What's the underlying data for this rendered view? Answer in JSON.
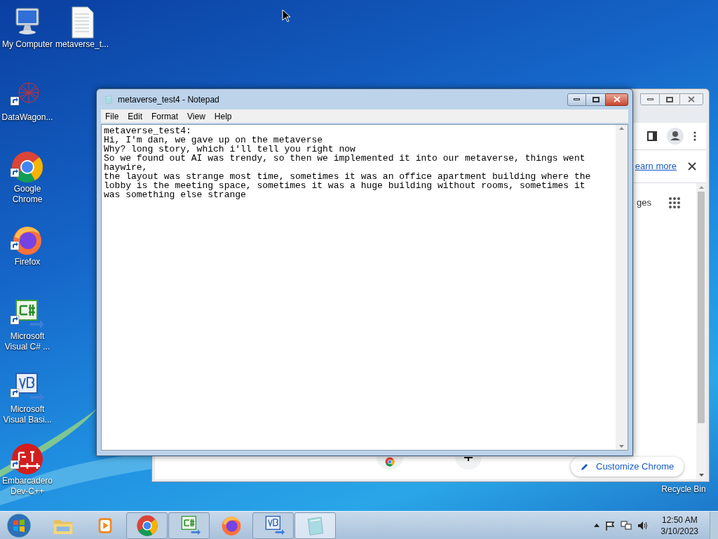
{
  "desktop_icons": [
    {
      "label": "My Computer",
      "kind": "computer"
    },
    {
      "label": "metaverse_t...",
      "kind": "document"
    },
    {
      "label": "DataWagon...",
      "kind": "datawagon"
    },
    {
      "label": "Google Chrome",
      "kind": "chrome"
    },
    {
      "label": "Firefox",
      "kind": "firefox"
    },
    {
      "label": "Microsoft Visual C# ...",
      "kind": "csharp"
    },
    {
      "label": "Microsoft Visual Basi...",
      "kind": "vb"
    },
    {
      "label": "Embarcadero Dev-C++",
      "kind": "devcpp"
    }
  ],
  "recycle_bin": {
    "label": "Recycle Bin"
  },
  "chrome": {
    "link": "earn more",
    "partial_text": "ges",
    "customize_button": "Customize Chrome"
  },
  "notepad": {
    "title": "metaverse_test4 - Notepad",
    "menu": [
      "File",
      "Edit",
      "Format",
      "View",
      "Help"
    ],
    "lines": [
      "metaverse_test4:",
      "Hi, I'm dan, we gave up on the metaverse",
      "Why? long story, which i'll tell you right now",
      "So we found out AI was trendy, so then we implemented it into our metaverse, things went",
      "haywire,",
      "the layout was strange most time, sometimes it was an office apartment building where the",
      "lobby is the meeting space, sometimes it was a huge building without rooms, sometimes it",
      "was something else strange"
    ]
  },
  "taskbar": {
    "items": [
      {
        "kind": "explorer",
        "running": false,
        "selected": false
      },
      {
        "kind": "mediaplayer",
        "running": false,
        "selected": false
      },
      {
        "kind": "chrome",
        "running": true,
        "selected": false
      },
      {
        "kind": "csharp",
        "running": true,
        "selected": false
      },
      {
        "kind": "firefox",
        "running": false,
        "selected": false
      },
      {
        "kind": "vb",
        "running": true,
        "selected": false
      },
      {
        "kind": "notepad",
        "running": true,
        "selected": true
      }
    ],
    "clock": {
      "time": "12:50 AM",
      "date": "3/10/2023"
    }
  }
}
